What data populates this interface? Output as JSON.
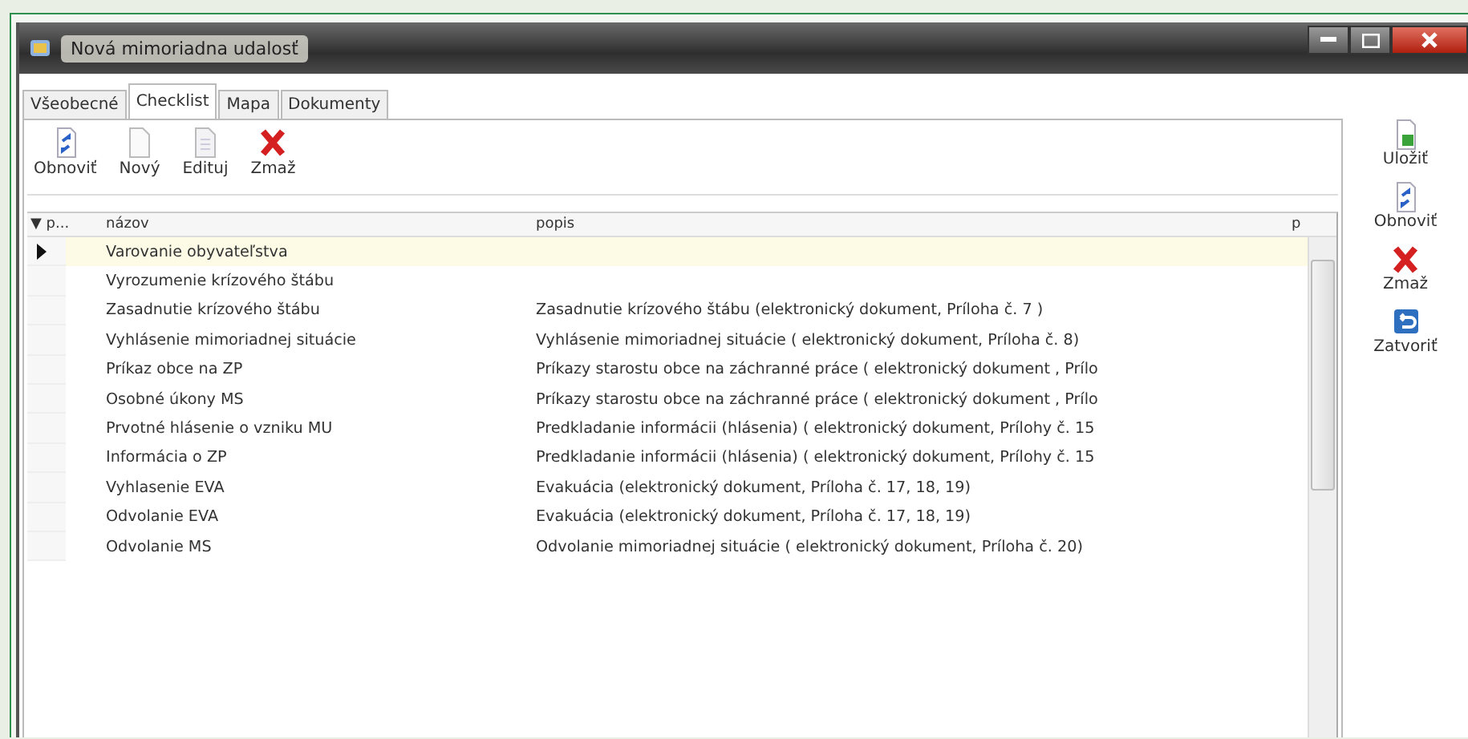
{
  "window": {
    "title": "Nová mimoriadna udalosť"
  },
  "tabs": [
    {
      "label": "Všeobecné",
      "selected": false
    },
    {
      "label": "Checklist",
      "selected": true
    },
    {
      "label": "Mapa",
      "selected": false
    },
    {
      "label": "Dokumenty",
      "selected": false
    }
  ],
  "toolbar": [
    {
      "label": "Obnoviť",
      "kind": "refresh"
    },
    {
      "label": "Nový",
      "kind": "new"
    },
    {
      "label": "Edituj",
      "kind": "edit"
    },
    {
      "label": "Zmaž",
      "kind": "delete"
    }
  ],
  "table": {
    "columns": [
      "▼ p...",
      "názov",
      "popis",
      "p"
    ],
    "rows": [
      {
        "name": "Varovanie obyvateľstva",
        "description": "",
        "selected": true
      },
      {
        "name": "Vyrozumenie krízového štábu",
        "description": "",
        "selected": false
      },
      {
        "name": "Zasadnutie krízového štábu",
        "description": "Zasadnutie krízového štábu (elektronický dokument, Príloha č. 7 )",
        "selected": false
      },
      {
        "name": "Vyhlásenie mimoriadnej situácie",
        "description": "Vyhlásenie mimoriadnej situácie ( elektronický dokument, Príloha č. 8)",
        "selected": false
      },
      {
        "name": "Príkaz obce na ZP",
        "description": "Príkazy starostu obce na záchranné práce ( elektronický dokument , Prílo",
        "selected": false
      },
      {
        "name": "Osobné úkony MS",
        "description": "Príkazy starostu obce na záchranné práce ( elektronický dokument , Prílo",
        "selected": false
      },
      {
        "name": "Prvotné hlásenie o vzniku MU",
        "description": "Predkladanie informácii (hlásenia)  ( elektronický dokument, Prílohy č.  15",
        "selected": false
      },
      {
        "name": "Informácia o ZP",
        "description": "Predkladanie informácii (hlásenia)  ( elektronický dokument, Prílohy č.  15",
        "selected": false
      },
      {
        "name": "Vyhlasenie EVA",
        "description": "Evakuácia  (elektronický dokument, Príloha č. 17, 18, 19)",
        "selected": false
      },
      {
        "name": "Odvolanie EVA",
        "description": "Evakuácia  (elektronický dokument, Príloha č. 17, 18, 19)",
        "selected": false
      },
      {
        "name": "Odvolanie MS",
        "description": "Odvolanie mimoriadnej situácie ( elektronický dokument, Príloha č.  20)",
        "selected": false
      }
    ]
  },
  "side_buttons": [
    {
      "label": "Uložiť",
      "kind": "save"
    },
    {
      "label": "Obnoviť",
      "kind": "refresh"
    },
    {
      "label": "Zmaž",
      "kind": "delete"
    },
    {
      "label": "Zatvoriť",
      "kind": "close"
    }
  ]
}
